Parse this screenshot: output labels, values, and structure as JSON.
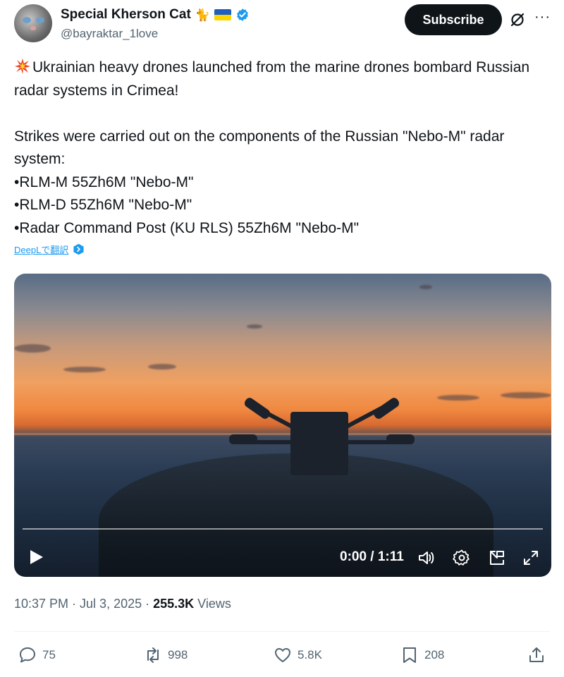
{
  "author": {
    "display_name": "Special Kherson Cat",
    "name_emoji": "🐈",
    "handle": "@bayraktar_1love",
    "verified_icon": "verified-badge-icon"
  },
  "header": {
    "subscribe_label": "Subscribe",
    "grok_icon": "grok-icon",
    "more_icon": "more-icon",
    "more_glyph": "···"
  },
  "tweet": {
    "emoji_icon": "collision-icon",
    "line1": "Ukrainian heavy drones launched from the marine drones bombard Russian radar systems in Crimea!",
    "line2": "Strikes were carried out on the components of the Russian \"Nebo-M\" radar system:",
    "bullets": [
      "•RLM-M 55Zh6M \"Nebo-M\"",
      "•RLM-D 55Zh6M \"Nebo-M\"",
      "•Radar Command Post (KU RLS) 55Zh6M \"Nebo-M\""
    ]
  },
  "translate": {
    "label": "DeepLで翻訳",
    "icon": "deepl-icon"
  },
  "video": {
    "time": "0:00 / 1:11",
    "progress": 0,
    "controls": [
      "play-icon",
      "volume-icon",
      "settings-icon",
      "pip-icon",
      "fullscreen-icon"
    ]
  },
  "meta": {
    "timestamp": "10:37 PM · Jul 3, 2025 · ",
    "views_count": "255.3K",
    "views_label": " Views"
  },
  "actions": {
    "replies": "75",
    "reposts": "998",
    "likes": "5.8K",
    "bookmarks": "208"
  },
  "colors": {
    "accent": "#1d9bf0",
    "text_primary": "#0f1419",
    "text_secondary": "#536471",
    "subscribe_bg": "#0f1419"
  }
}
